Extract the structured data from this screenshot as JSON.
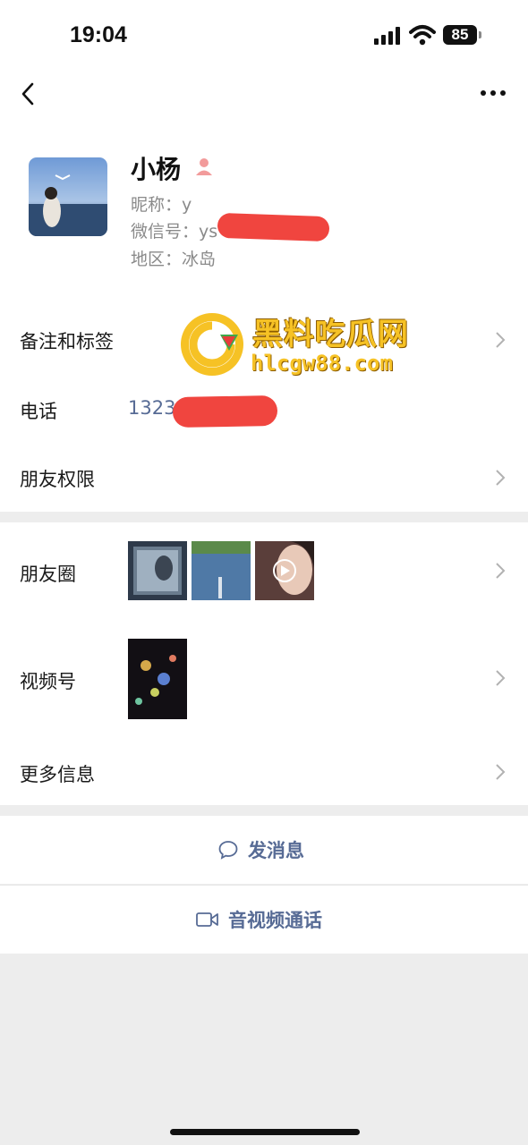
{
  "status_bar": {
    "time": "19:04",
    "battery": "85"
  },
  "profile": {
    "name": "小杨",
    "nickname": "昵称：y",
    "wechat_id": "微信号：ys",
    "region": "地区：冰岛"
  },
  "rows": {
    "remark_tags": "备注和标签",
    "phone_label": "电话",
    "phone_value": "1323",
    "friend_permissions": "朋友权限",
    "moments": "朋友圈",
    "channels": "视频号",
    "more_info": "更多信息"
  },
  "actions": {
    "send_message": "发消息",
    "av_call": "音视频通话"
  },
  "watermark": {
    "title": "黑料吃瓜网",
    "url": "hlcgw88.com"
  },
  "colors": {
    "link": "#576b95",
    "redaction": "#f0453f",
    "watermark": "#f6c225"
  }
}
